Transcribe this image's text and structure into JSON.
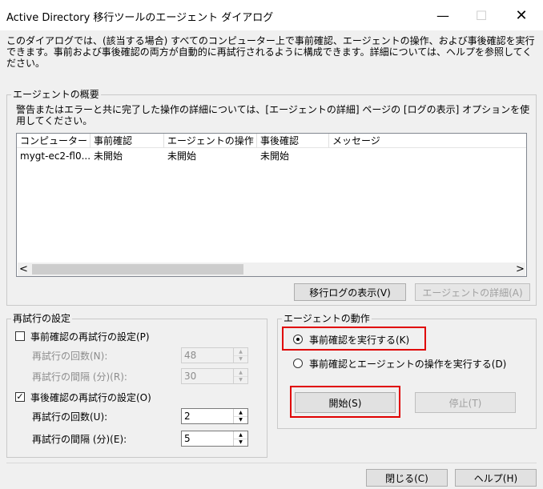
{
  "window": {
    "title": "Active Directory 移行ツールのエージェント ダイアログ",
    "minimize_glyph": "—",
    "maximize_glyph": "☐",
    "close_glyph": "✕"
  },
  "intro": "このダイアログでは、(該当する場合) すべてのコンピューター上で事前確認、エージェントの操作、および事後確認を実行できます。事前および事後確認の両方が自動的に再試行されるように構成できます。詳細については、ヘルプを参照してください。",
  "summary": {
    "title": "エージェントの概要",
    "description": "警告またはエラーと共に完了した操作の詳細については、[エージェントの詳細] ページの [ログの表示] オプションを使用してください。",
    "columns": [
      "コンピューター",
      "事前確認",
      "エージェントの操作",
      "事後確認",
      "メッセージ"
    ],
    "rows": [
      [
        "mygt-ec2-fl0...",
        "未開始",
        "未開始",
        "未開始",
        ""
      ]
    ],
    "scroll_left": "<",
    "scroll_right": ">",
    "view_log_button": "移行ログの表示(V)",
    "agent_detail_button": "エージェントの詳細(A)"
  },
  "retry": {
    "title": "再試行の設定",
    "pre_check": {
      "label": "事前確認の再試行の設定(P)",
      "checked": false,
      "count_label": "再試行の回数(N):",
      "count_value": "48",
      "interval_label": "再試行の間隔 (分)(R):",
      "interval_value": "30"
    },
    "post_check": {
      "label": "事後確認の再試行の設定(O)",
      "checked": true,
      "check_glyph": "✓",
      "count_label": "再試行の回数(U):",
      "count_value": "2",
      "interval_label": "再試行の間隔 (分)(E):",
      "interval_value": "5"
    }
  },
  "agent_action": {
    "title": "エージェントの動作",
    "option_precheck": "事前確認を実行する(K)",
    "option_precheck_and_agent": "事前確認とエージェントの操作を実行する(D)",
    "selected": "precheck",
    "start_button": "開始(S)",
    "stop_button": "停止(T)"
  },
  "footer": {
    "close_button": "閉じる(C)",
    "help_button": "ヘルプ(H)"
  },
  "colors": {
    "highlight": "#e00000",
    "window_bg": "#f0f0f0",
    "button_bg": "#e1e1e1"
  }
}
